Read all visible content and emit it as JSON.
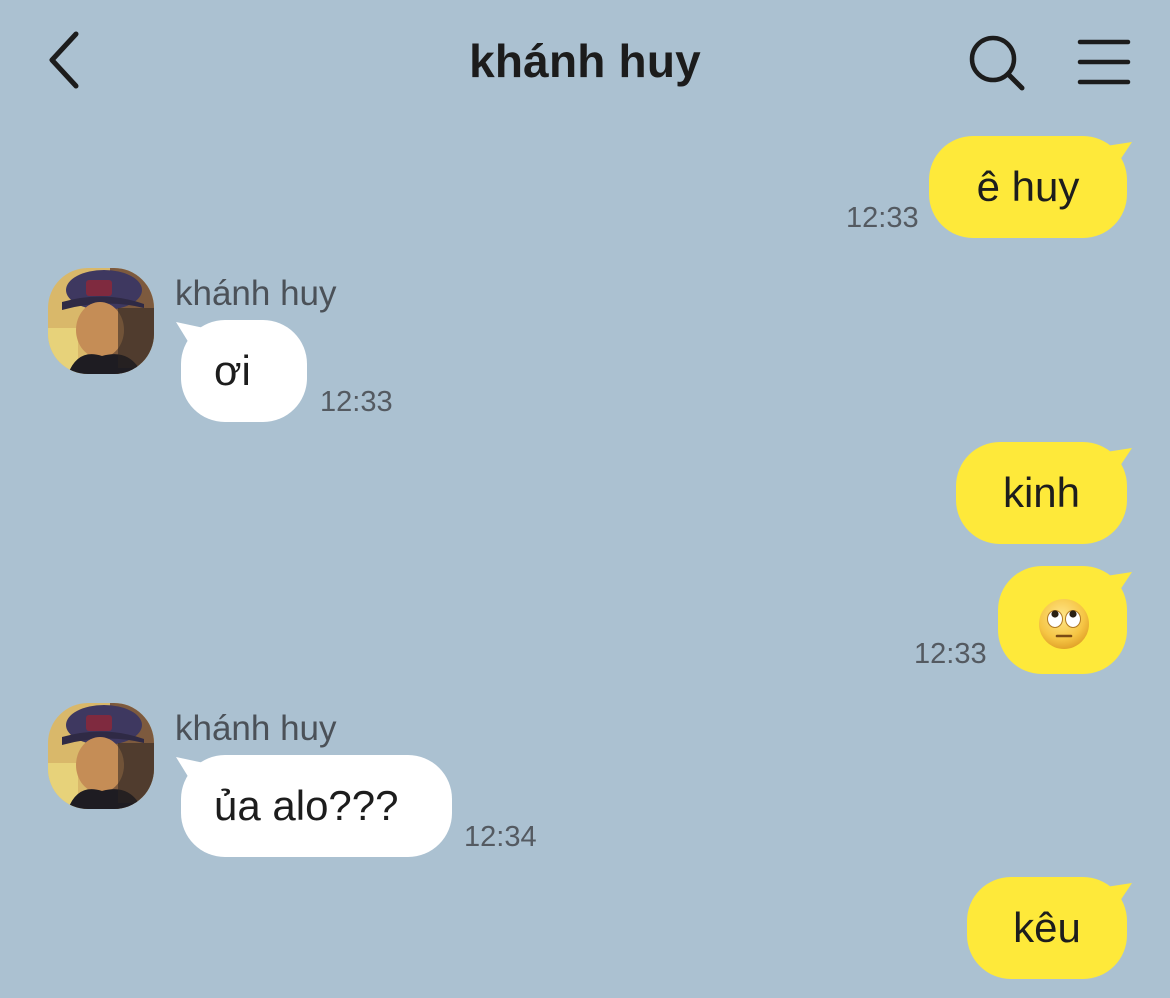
{
  "header": {
    "title": "khánh huy",
    "back_icon": "chevron-left-icon",
    "search_icon": "search-icon",
    "menu_icon": "hamburger-menu-icon"
  },
  "colors": {
    "background": "#abc1d1",
    "sent_bubble": "#fee93a",
    "received_bubble": "#ffffff"
  },
  "messages": [
    {
      "direction": "sent",
      "text": "ê huy",
      "time": "12:33"
    },
    {
      "direction": "received",
      "sender": "khánh huy",
      "text": "ơi",
      "time": "12:33"
    },
    {
      "direction": "sent",
      "text": "kinh",
      "time": ""
    },
    {
      "direction": "sent",
      "text": "",
      "emoji": "face-with-rolling-eyes",
      "time": "12:33"
    },
    {
      "direction": "received",
      "sender": "khánh huy",
      "text": "ủa alo???",
      "time": "12:34"
    },
    {
      "direction": "sent",
      "text": "kêu",
      "time": ""
    }
  ]
}
